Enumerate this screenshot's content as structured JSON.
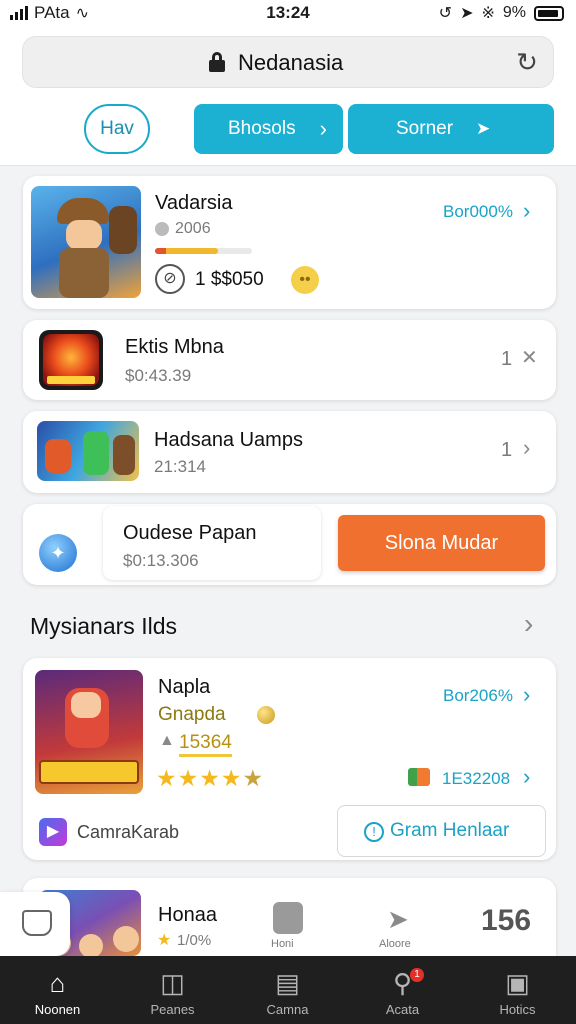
{
  "status_bar": {
    "carrier": "PAta",
    "time": "13:24",
    "battery": "9%"
  },
  "browser": {
    "url": "Nedanasia",
    "filter_pill": "Hav",
    "btn_browse": "Bhosols",
    "btn_sorner": "Sorner"
  },
  "featured": {
    "title": "Vadarsia",
    "meta": "2006",
    "progress": 0.65,
    "price": "1 $$050",
    "link": "Bor000%"
  },
  "list": [
    {
      "title": "Ektis Mbna",
      "subtitle": "$0:43.39",
      "count": "1"
    },
    {
      "title": "Hadsana Uamps",
      "subtitle": "21:314",
      "count": "1"
    }
  ],
  "promo": {
    "title": "Oudese Papan",
    "subtitle": "$0:13.306",
    "button": "Slona Mudar"
  },
  "section": {
    "title": "Mysianars Ilds"
  },
  "game_card": {
    "title": "Napla",
    "subtitle": "Gnapda",
    "score": "15364",
    "link": "Bor206%",
    "stat": "1E32208",
    "rating": 4,
    "brand": "CamraKarab",
    "button": "Gram Henlaar"
  },
  "peek_card": {
    "title": "Honaa",
    "rating_text": "1/0%",
    "icon1_label": "Honi",
    "icon2_label": "Aloore",
    "number": "156"
  },
  "bottom_nav": [
    {
      "label": "Noonen"
    },
    {
      "label": "Peanes"
    },
    {
      "label": "Camna"
    },
    {
      "label": "Acata",
      "badge": "1"
    },
    {
      "label": "Hotics"
    }
  ]
}
